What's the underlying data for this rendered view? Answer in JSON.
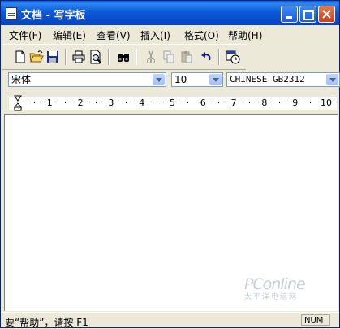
{
  "window": {
    "title": "文档 - 写字板"
  },
  "menu": [
    "文件(F)",
    "编辑(E)",
    "查看(V)",
    "插入(I)",
    "格式(O)",
    "帮助(H)"
  ],
  "toolbar": {
    "tools": [
      "new-document-icon",
      "open-folder-icon",
      "save-icon",
      "print-icon",
      "print-preview-icon",
      "find-icon",
      "cut-icon",
      "copy-icon",
      "paste-icon",
      "undo-icon",
      "date-time-icon"
    ]
  },
  "format": {
    "font": "宋体",
    "size": "10",
    "script": "CHINESE_GB2312"
  },
  "ruler": {
    "labels": [
      "1",
      "2",
      "3",
      "4",
      "5",
      "6",
      "7",
      "8",
      "9",
      "10"
    ]
  },
  "watermark": {
    "brand": "PConline",
    "sub": "太平洋电脑网"
  },
  "status": {
    "text": "要“帮助”，请按 F1",
    "num": "NUM"
  },
  "colors": {
    "title_bar": "#0b5ad9",
    "chrome": "#ece9d8",
    "close_button": "#c7401b"
  }
}
